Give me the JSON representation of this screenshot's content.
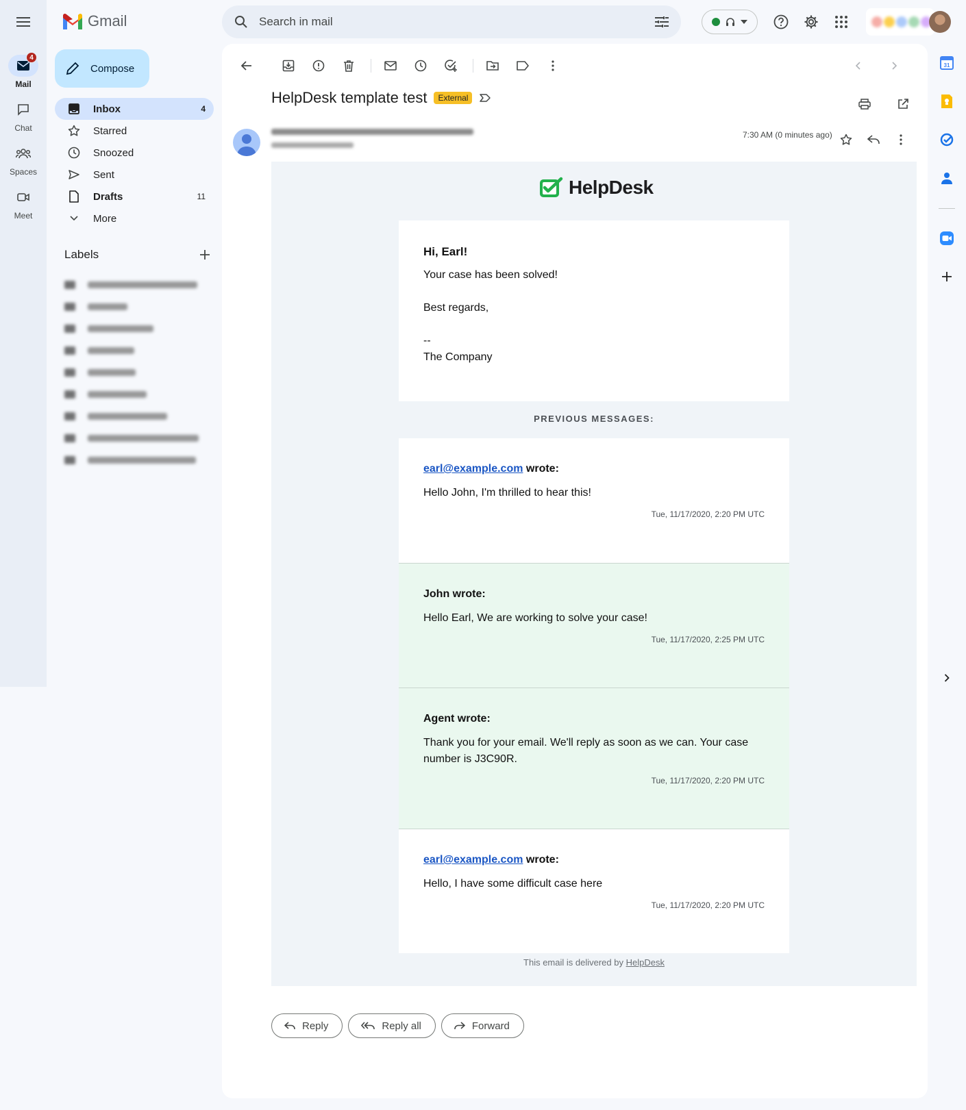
{
  "app": {
    "name": "Gmail"
  },
  "rail": [
    {
      "label": "Mail",
      "badge": "4",
      "icon": "mail-icon"
    },
    {
      "label": "Chat",
      "icon": "chat-icon"
    },
    {
      "label": "Spaces",
      "icon": "spaces-icon"
    },
    {
      "label": "Meet",
      "icon": "meet-icon"
    }
  ],
  "search": {
    "placeholder": "Search in mail"
  },
  "compose": {
    "label": "Compose"
  },
  "nav": [
    {
      "label": "Inbox",
      "count": "4"
    },
    {
      "label": "Starred",
      "count": ""
    },
    {
      "label": "Snoozed",
      "count": ""
    },
    {
      "label": "Sent",
      "count": ""
    },
    {
      "label": "Drafts",
      "count": "11"
    },
    {
      "label": "More",
      "count": ""
    }
  ],
  "labels": {
    "heading": "Labels"
  },
  "message": {
    "subject": "HelpDesk template test",
    "badge": "External",
    "time": "7:30 AM (0 minutes ago)"
  },
  "email": {
    "brand": "HelpDesk",
    "greeting": "Hi, Earl!",
    "line1": "Your case has been solved!",
    "regards": "Best regards,",
    "dashes": "--",
    "company": "The Company",
    "previous_heading": "PREVIOUS MESSAGES:",
    "previous": [
      {
        "email": "earl@example.com",
        "author": "",
        "suffix": " wrote:",
        "text": "Hello John, I'm thrilled to hear this!",
        "stamp": "Tue, 11/17/2020, 2:20 PM UTC"
      },
      {
        "email": "",
        "author": "John wrote:",
        "suffix": "",
        "text": "Hello Earl, We are working to solve your case!",
        "stamp": "Tue, 11/17/2020, 2:25 PM UTC"
      },
      {
        "email": "",
        "author": "Agent wrote:",
        "suffix": "",
        "text": "Thank you for your email. We'll reply as soon as we can. Your case number is J3C90R.",
        "stamp": "Tue, 11/17/2020, 2:20 PM UTC"
      },
      {
        "email": "earl@example.com",
        "author": "",
        "suffix": " wrote:",
        "text": "Hello, I have some difficult case here",
        "stamp": "Tue, 11/17/2020, 2:20 PM UTC"
      }
    ],
    "delivered_prefix": "This email is delivered by ",
    "delivered_link": "HelpDesk"
  },
  "actions": {
    "reply": "Reply",
    "reply_all": "Reply all",
    "forward": "Forward"
  },
  "colors": {
    "accent": "#c2e7ff",
    "active_nav": "#d3e3fd",
    "external": "#f6bf26",
    "helpdesk_green": "#22b14c"
  }
}
